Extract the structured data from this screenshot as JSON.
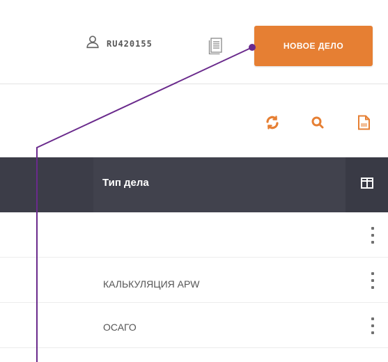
{
  "header": {
    "user_id": "RU420155",
    "new_case_button": "НОВОЕ ДЕЛО"
  },
  "toolbar": {
    "icons": [
      "refresh-icon",
      "search-icon",
      "export-file-icon"
    ]
  },
  "table": {
    "column_header": "Тип дела",
    "rows": [
      {
        "type": ""
      },
      {
        "type": "КАЛЬКУЛЯЦИЯ APW"
      },
      {
        "type": "ОСАГО"
      }
    ]
  },
  "colors": {
    "accent": "#e67f33",
    "header_bg": "#3e3f4a",
    "callout": "#6a2a8c"
  }
}
